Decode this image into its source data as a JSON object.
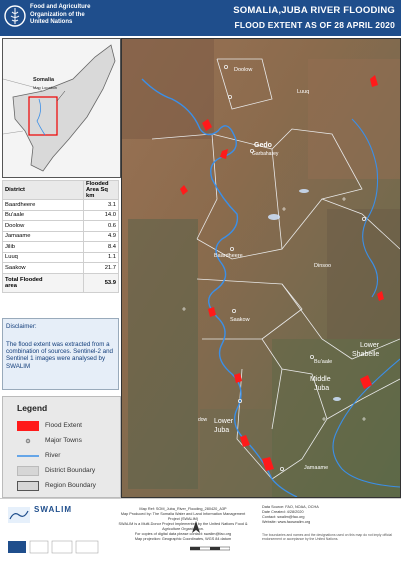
{
  "header": {
    "org_line1": "Food and Agriculture",
    "org_line2": "Organization of the",
    "org_line3": "United Nations",
    "title": "SOMALIA,JUBA RIVER FLOODING",
    "subtitle": "FLOOD EXTENT AS OF 28 APRIL 2020"
  },
  "inset": {
    "country_label": "Somalia",
    "location_label": "Map Location"
  },
  "table": {
    "col_district": "District",
    "col_area": "Flooded Area Sq km",
    "rows": [
      {
        "district": "Baardheere",
        "area": "3.1"
      },
      {
        "district": "Bu'aale",
        "area": "14.0"
      },
      {
        "district": "Doolow",
        "area": "0.6"
      },
      {
        "district": "Jamaame",
        "area": "4.9"
      },
      {
        "district": "Jilib",
        "area": "8.4"
      },
      {
        "district": "Luuq",
        "area": "1.1"
      },
      {
        "district": "Saakow",
        "area": "21.7"
      }
    ],
    "total_label_1": "Total Flooded",
    "total_label_2": "area",
    "total_value": "53.9"
  },
  "disclaimer": {
    "heading": "Disclaimer:",
    "text": "The flood extent was extracted from a combination of sources. Sentinel-2 and Sentinel 1 images were analysed by SWALIM"
  },
  "legend": {
    "title": "Legend",
    "items": [
      {
        "label": "Flood Extent"
      },
      {
        "label": "Major Towns"
      },
      {
        "label": "River"
      },
      {
        "label": "District Boundary"
      },
      {
        "label": "Region Boundary"
      }
    ]
  },
  "map": {
    "labels": {
      "doolow": "Doolow",
      "luuq": "Luuq",
      "gedo1": "Gedo",
      "gedo2": "Garbaharey",
      "baardheere": "Baardheere",
      "dinsor": "Dinsoo",
      "saakow": "Saakow",
      "buaale": "Bu'aale",
      "lower_shabelle1": "Lower",
      "lower_shabelle2": "Shabelle",
      "middle_juba1": "Middle",
      "middle_juba2": "Juba",
      "lower_juba1": "Lower",
      "lower_juba2": "Juba",
      "jamaame": "Jamaame",
      "dow": "dow"
    },
    "colors": {
      "flood": "#ff1a1a",
      "river": "#3b8fe8",
      "boundary": "#e6e6e6"
    }
  },
  "footer": {
    "swalim": "SWALIM",
    "line1": "Map Ref: SOM_Juba_River_Flooding_280420_A3P",
    "line2": "Map Produced by: The Somalia Water and Land Information Management Project (SWALIM)",
    "line3": "SWALIM is a Multi-Donor Project Implemented by the United Nations Food & Agriculture Organization.",
    "line4": "For copies of digital data please contact: swalim@fao.org",
    "line5": "Map projection: Geographic Coordinates, WGS 84 datum",
    "data_source_label": "Data Source:",
    "data_source": "FAO, NOAA, OCHA",
    "date_created_label": "Date Created:",
    "date_created": "4/28/2020",
    "contact_label": "Contact:",
    "contact": "swalim@fao.org",
    "web_label": "Website:",
    "website": "www.faoswalim.org",
    "boundaries_note": "The boundaries and names and the designations used on this map do not imply official endorsement or acceptance by the United Nations."
  }
}
